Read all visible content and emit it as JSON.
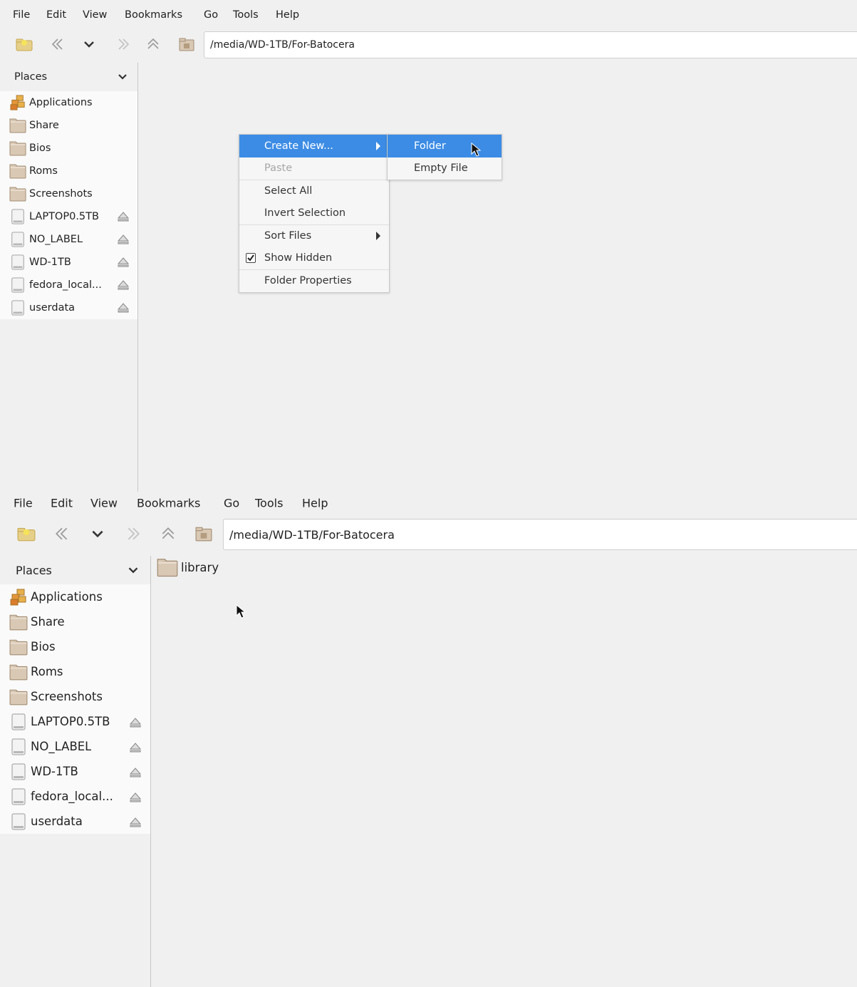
{
  "menubar": [
    "File",
    "Edit",
    "View",
    "Bookmarks",
    "Go",
    "Tools",
    "Help"
  ],
  "path": "/media/WD-1TB/For-Batocera",
  "places_label": "Places",
  "places": [
    {
      "label": "Applications",
      "icon": "applications-icon",
      "eject": false
    },
    {
      "label": "Share",
      "icon": "folder-icon",
      "eject": false
    },
    {
      "label": "Bios",
      "icon": "folder-icon",
      "eject": false
    },
    {
      "label": "Roms",
      "icon": "folder-icon",
      "eject": false
    },
    {
      "label": "Screenshots",
      "icon": "folder-icon",
      "eject": false
    },
    {
      "label": "LAPTOP0.5TB",
      "icon": "drive-icon",
      "eject": true
    },
    {
      "label": "NO_LABEL",
      "icon": "drive-icon",
      "eject": true
    },
    {
      "label": "WD-1TB",
      "icon": "drive-icon",
      "eject": true
    },
    {
      "label": "fedora_local...",
      "icon": "drive-icon",
      "eject": true
    },
    {
      "label": "userdata",
      "icon": "drive-icon",
      "eject": true
    }
  ],
  "context_menu": [
    {
      "label": "Create New...",
      "submenu": true,
      "selected": true
    },
    {
      "label": "Paste",
      "disabled": true
    },
    {
      "label": "Select All"
    },
    {
      "label": "Invert Selection"
    },
    {
      "label": "Sort Files",
      "submenu": true
    },
    {
      "label": "Show Hidden",
      "checked": true
    },
    {
      "label": "Folder Properties"
    }
  ],
  "submenu": [
    {
      "label": "Folder",
      "selected": true
    },
    {
      "label": "Empty File"
    }
  ],
  "files": [
    {
      "name": "library",
      "icon": "folder-icon"
    }
  ],
  "colors": {
    "selection": "#3c8ce5",
    "background": "#f0f0f0",
    "sidebar_list": "#fafafa",
    "folder": "#d9c8b4"
  }
}
